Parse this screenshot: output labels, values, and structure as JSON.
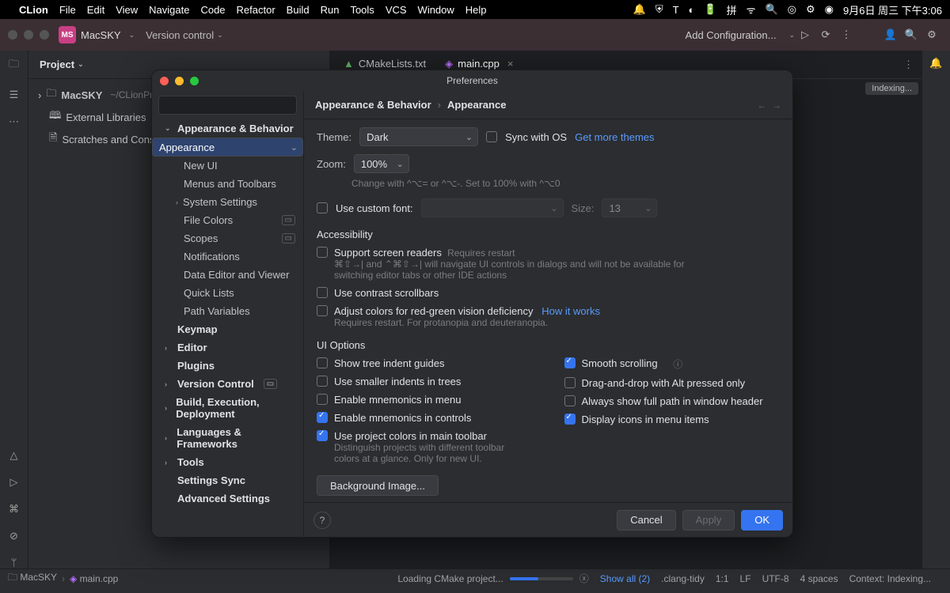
{
  "menubar": {
    "app": "CLion",
    "items": [
      "File",
      "Edit",
      "View",
      "Navigate",
      "Code",
      "Refactor",
      "Build",
      "Run",
      "Tools",
      "VCS",
      "Window",
      "Help"
    ],
    "clock": "9月6日 周三 下午3:06"
  },
  "titlebar": {
    "badge": "MS",
    "project": "MacSKY",
    "vc": "Version control",
    "addconf": "Add Configuration..."
  },
  "project": {
    "header": "Project",
    "root": "MacSKY",
    "root_path": "~/CLionProj...",
    "libs": "External Libraries",
    "scratches": "Scratches and Conso..."
  },
  "tabs": {
    "cmake": "CMakeLists.txt",
    "main": "main.cpp"
  },
  "editor": {
    "indexing_chip": "Indexing..."
  },
  "dialog": {
    "title": "Preferences",
    "search_placeholder": "",
    "sidebar": {
      "appearance_behavior": "Appearance & Behavior",
      "appearance": "Appearance",
      "new_ui": "New UI",
      "menus": "Menus and Toolbars",
      "system_settings": "System Settings",
      "file_colors": "File Colors",
      "scopes": "Scopes",
      "notifications": "Notifications",
      "data_editor": "Data Editor and Viewer",
      "quick_lists": "Quick Lists",
      "path_variables": "Path Variables",
      "keymap": "Keymap",
      "editor": "Editor",
      "plugins": "Plugins",
      "version_control": "Version Control",
      "build": "Build, Execution, Deployment",
      "languages": "Languages & Frameworks",
      "tools": "Tools",
      "settings_sync": "Settings Sync",
      "advanced": "Advanced Settings"
    },
    "crumb": {
      "a": "Appearance & Behavior",
      "b": "Appearance"
    },
    "content": {
      "theme_label": "Theme:",
      "theme_value": "Dark",
      "sync_os": "Sync with OS",
      "get_more": "Get more themes",
      "zoom_label": "Zoom:",
      "zoom_value": "100%",
      "zoom_hint": "Change with ^⌥= or ^⌥-. Set to 100% with ^⌥0",
      "custom_font": "Use custom font:",
      "size_label": "Size:",
      "size_value": "13",
      "accessibility": "Accessibility",
      "screen_readers": "Support screen readers",
      "requires_restart": "Requires restart",
      "sr_hint": "⌘⇧→| and ⌃⌘⇧→| will navigate UI controls in dialogs and will not be available for switching editor tabs or other IDE actions",
      "contrast_sb": "Use contrast scrollbars",
      "adjust_colors": "Adjust colors for red-green vision deficiency",
      "how_works": "How it works",
      "adjust_hint": "Requires restart. For protanopia and deuteranopia.",
      "ui_options": "UI Options",
      "opt_tree_guides": "Show tree indent guides",
      "opt_smaller_indents": "Use smaller indents in trees",
      "opt_mnemonics_menu": "Enable mnemonics in menu",
      "opt_mnemonics_ctrl": "Enable mnemonics in controls",
      "opt_project_colors": "Use project colors in main toolbar",
      "opt_project_colors_hint": "Distinguish projects with different toolbar colors at a glance. Only for new UI.",
      "opt_smooth": "Smooth scrolling",
      "opt_dnd": "Drag-and-drop with Alt pressed only",
      "opt_fullpath": "Always show full path in window header",
      "opt_icons": "Display icons in menu items",
      "bg_image": "Background Image..."
    },
    "buttons": {
      "cancel": "Cancel",
      "apply": "Apply",
      "ok": "OK"
    }
  },
  "statusbar": {
    "breadcrumb_a": "MacSKY",
    "breadcrumb_b": "main.cpp",
    "loading": "Loading CMake project...",
    "show_all": "Show all (2)",
    "clang": ".clang-tidy",
    "pos": "1:1",
    "lf": "LF",
    "enc": "UTF-8",
    "indent": "4 spaces",
    "context": "Context: Indexing..."
  }
}
